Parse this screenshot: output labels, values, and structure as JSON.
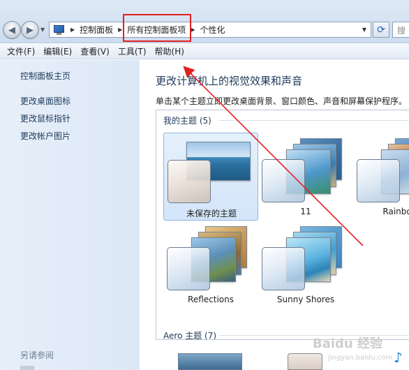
{
  "address": {
    "breadcrumbs": [
      "控制面板",
      "所有控制面板项",
      "个性化"
    ],
    "search_placeholder": "搜"
  },
  "menu": [
    "文件(F)",
    "编辑(E)",
    "查看(V)",
    "工具(T)",
    "帮助(H)"
  ],
  "sidebar": {
    "links": [
      "控制面板主页",
      "更改桌面图标",
      "更改鼠标指针",
      "更改帐户图片"
    ],
    "see_also": "另请参阅"
  },
  "main": {
    "title": "更改计算机上的视觉效果和声音",
    "description": "单击某个主题立即更改桌面背景、窗口颜色、声音和屏幕保护程序。",
    "my_themes_label": "我的主题 (5)",
    "aero_themes_label": "Aero 主题 (7)",
    "themes": [
      "未保存的主题",
      "11",
      "Rainbow",
      "Reflections",
      "Sunny Shores"
    ]
  },
  "watermark": {
    "brand": "Baidu 经验",
    "url": "jingyan.baidu.com"
  },
  "colors": {
    "highlight": "#e02020",
    "link": "#1e395b",
    "sidebar_bg": "#dce8f6"
  }
}
